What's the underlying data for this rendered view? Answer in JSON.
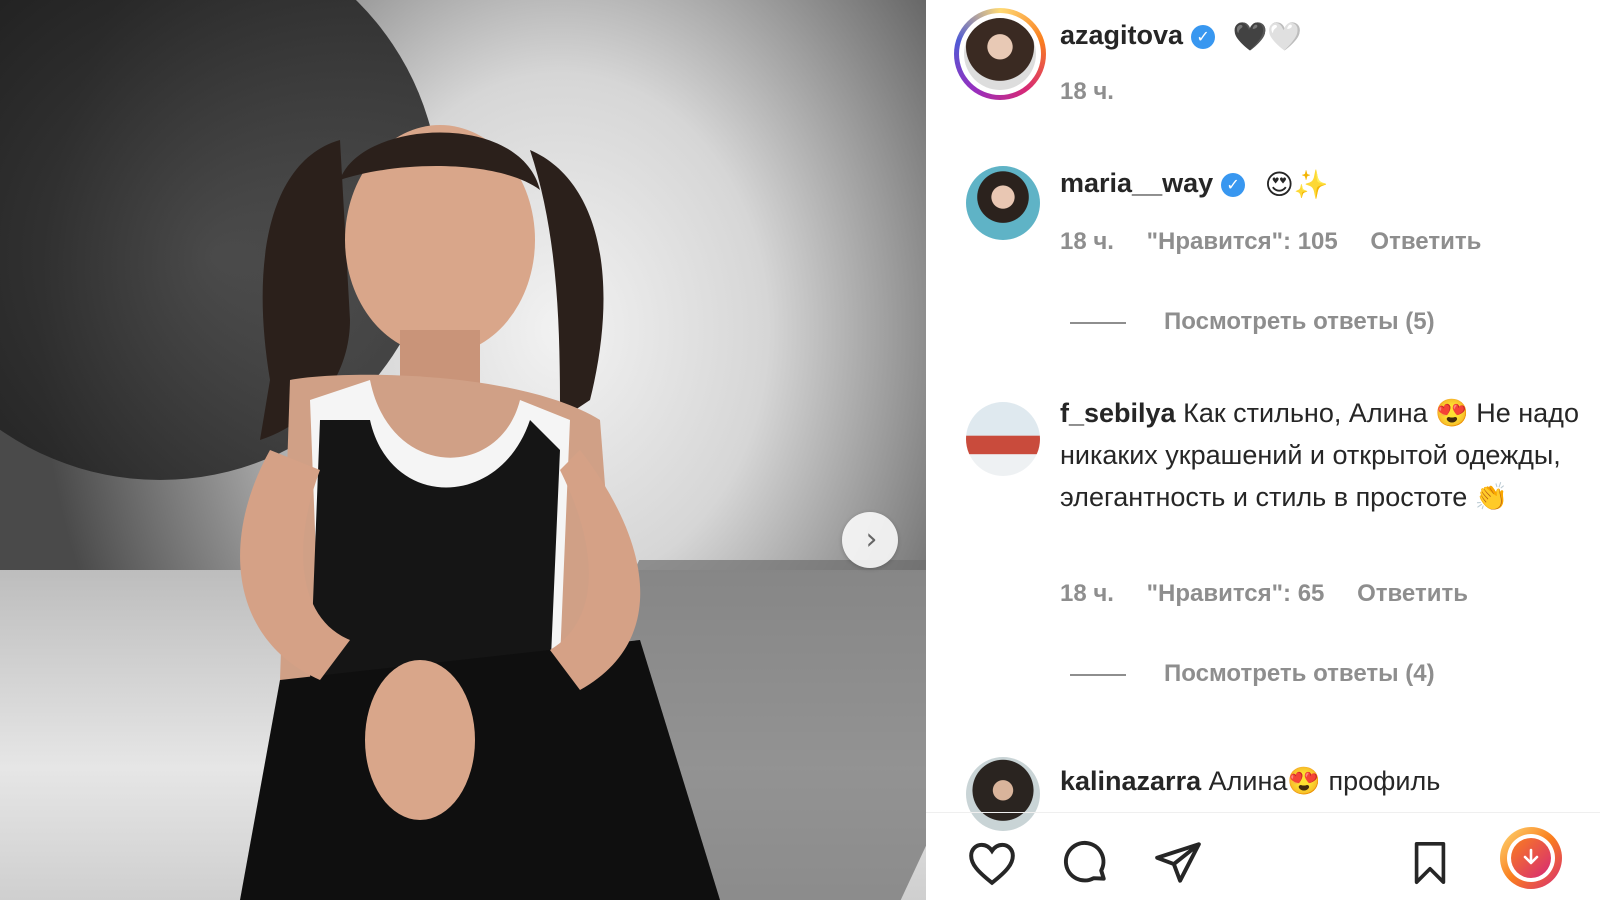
{
  "post": {
    "owner": {
      "username": "azagitova",
      "time": "18 ч.",
      "emojis": "🖤🤍"
    },
    "carousel": {
      "next_icon": "›"
    }
  },
  "comments": [
    {
      "username": "maria__way",
      "verified": true,
      "text": "😍✨",
      "time": "18 ч.",
      "likes": "\"Нравится\": 105",
      "reply": "Ответить",
      "view_replies": "Посмотреть ответы (5)"
    },
    {
      "username": "f_sebilya",
      "verified": false,
      "text": "Как стильно, Алина 😍 Не надо никаких украшений и открытой одежды, элегантность и стиль в простоте 👏",
      "time": "18 ч.",
      "likes": "\"Нравится\": 65",
      "reply": "Ответить",
      "view_replies": "Посмотреть ответы (4)"
    },
    {
      "username": "kalinazarra",
      "verified": false,
      "text": "Алина😍 профиль"
    }
  ],
  "actions": {
    "like": "heart-icon",
    "comment": "comment-icon",
    "share": "send-icon",
    "save": "bookmark-icon",
    "download": "download-icon"
  },
  "colors": {
    "verified": "#3897f0",
    "secondary_text": "#8e8e8e",
    "download_gradient": [
      "#feda75",
      "#d62976"
    ]
  }
}
